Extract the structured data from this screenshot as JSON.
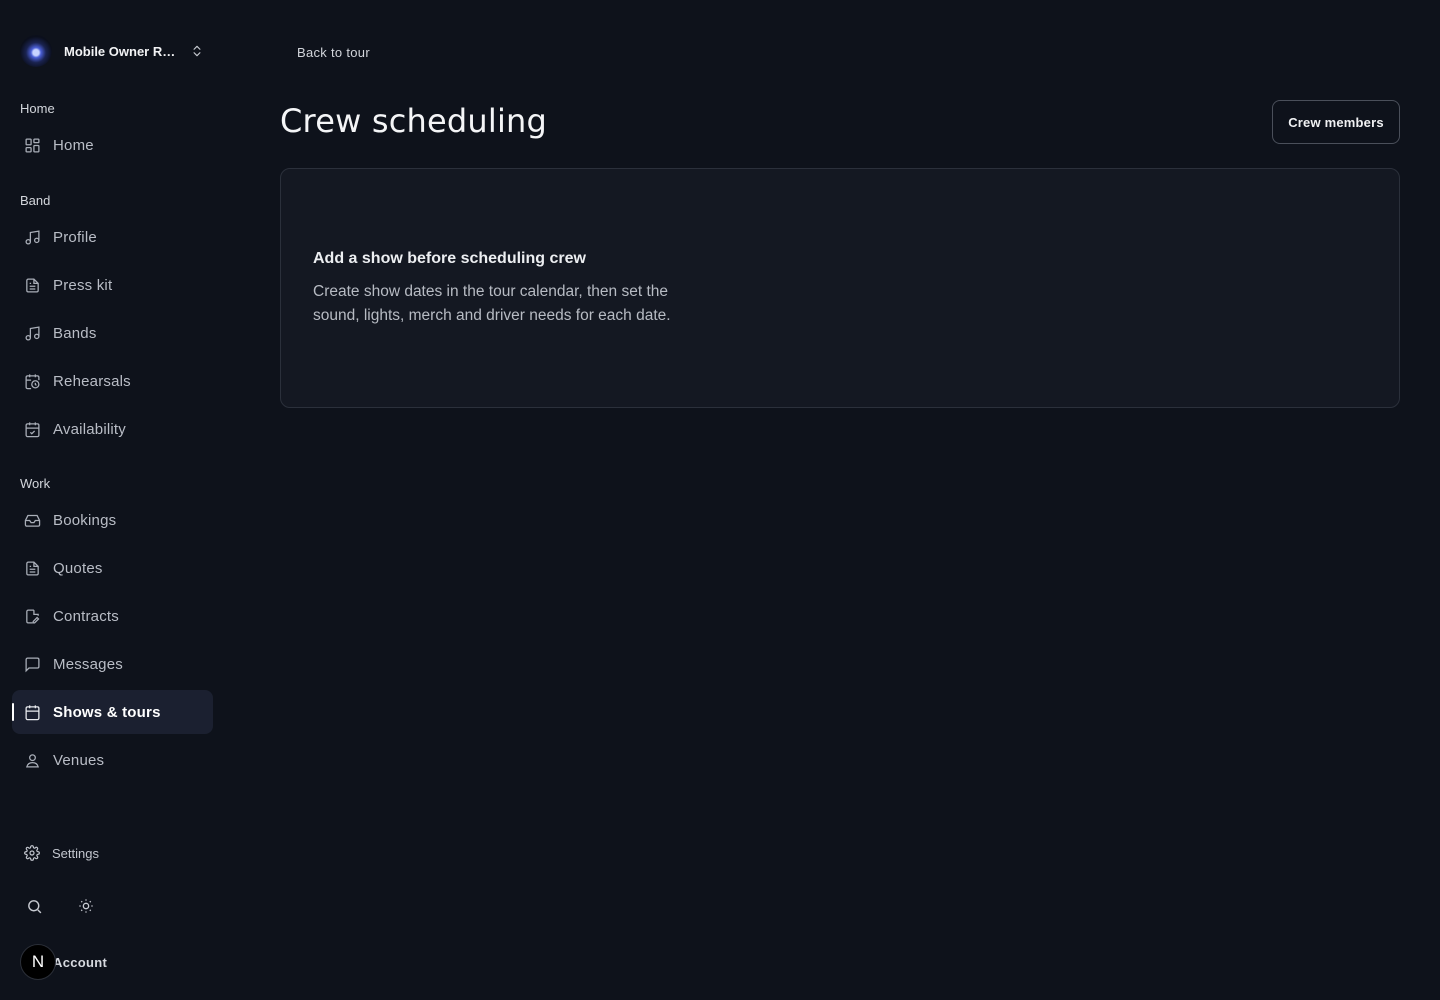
{
  "org": {
    "name": "Mobile Owner Re..."
  },
  "sidebar": {
    "sections": [
      {
        "label": "Home",
        "items": [
          {
            "label": "Home",
            "icon": "grid-icon"
          }
        ]
      },
      {
        "label": "Band",
        "items": [
          {
            "label": "Profile",
            "icon": "music-note-icon"
          },
          {
            "label": "Press kit",
            "icon": "document-icon"
          },
          {
            "label": "Bands",
            "icon": "music-note-icon"
          },
          {
            "label": "Rehearsals",
            "icon": "calendar-clock-icon"
          },
          {
            "label": "Availability",
            "icon": "calendar-check-icon"
          }
        ]
      },
      {
        "label": "Work",
        "items": [
          {
            "label": "Bookings",
            "icon": "inbox-icon"
          },
          {
            "label": "Quotes",
            "icon": "document-icon"
          },
          {
            "label": "Contracts",
            "icon": "document-edit-icon"
          },
          {
            "label": "Messages",
            "icon": "message-icon"
          },
          {
            "label": "Shows & tours",
            "icon": "calendar-icon",
            "active": true
          },
          {
            "label": "Venues",
            "icon": "user-pin-icon"
          }
        ]
      }
    ],
    "settings_label": "Settings",
    "account": {
      "initial": "N",
      "label": "Account"
    }
  },
  "main": {
    "back_label": "Back to tour",
    "title": "Crew scheduling",
    "crew_button_label": "Crew members",
    "empty_state": {
      "title": "Add a show before scheduling crew",
      "text": "Create show dates in the tour calendar, then set the sound, lights, merch and driver needs for each date."
    }
  },
  "colors": {
    "background": "#0e121b",
    "active_item_bg": "#1b2030",
    "card_bg": "#141822",
    "card_border": "#2b303b"
  }
}
